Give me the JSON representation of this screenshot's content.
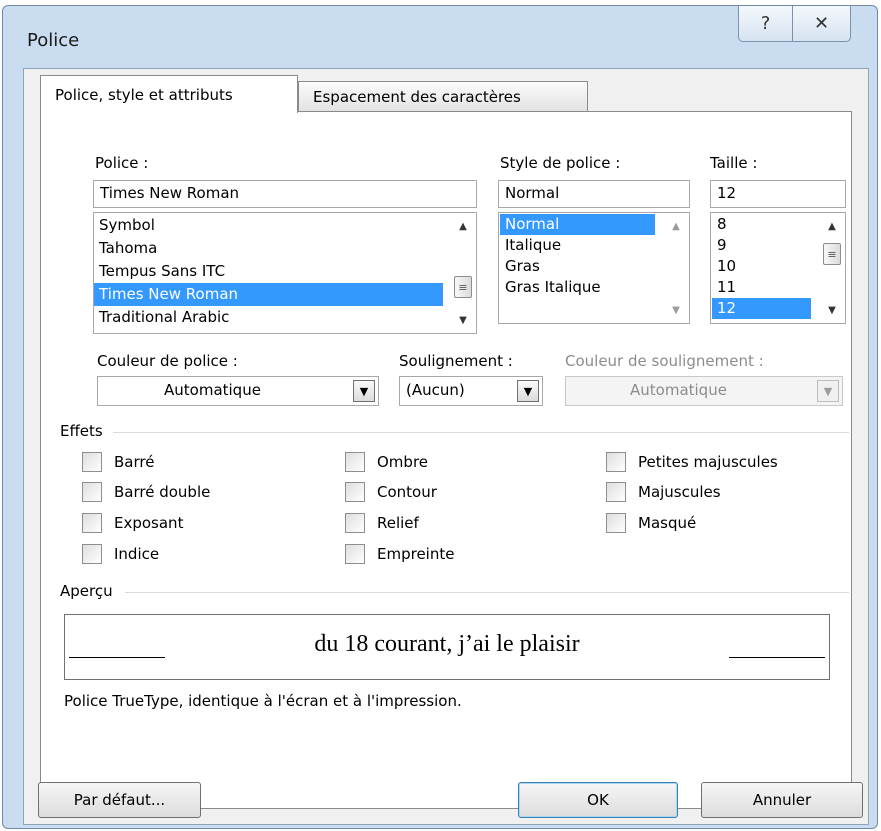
{
  "window": {
    "title": "Police",
    "help_glyph": "?",
    "close_glyph": "✕"
  },
  "tabs": [
    {
      "label": "Police, style et attributs",
      "active": true
    },
    {
      "label": "Espacement des caractères",
      "active": false
    }
  ],
  "font": {
    "label": "Police :",
    "value": "Times New Roman",
    "items": [
      "Symbol",
      "Tahoma",
      "Tempus Sans ITC",
      "Times New Roman",
      "Traditional Arabic"
    ],
    "selected": "Times New Roman"
  },
  "style": {
    "label": "Style de police :",
    "value": "Normal",
    "items": [
      "Normal",
      "Italique",
      "Gras",
      "Gras Italique"
    ],
    "selected": "Normal"
  },
  "size": {
    "label": "Taille :",
    "value": "12",
    "items": [
      "8",
      "9",
      "10",
      "11",
      "12"
    ],
    "selected": "12"
  },
  "font_color": {
    "label": "Couleur de police :",
    "value": "Automatique"
  },
  "underline": {
    "label": "Soulignement :",
    "value": "(Aucun)"
  },
  "underline_color": {
    "label": "Couleur de soulignement :",
    "value": "Automatique",
    "enabled": false
  },
  "effects": {
    "title": "Effets",
    "col1": [
      "Barré",
      "Barré double",
      "Exposant",
      "Indice"
    ],
    "col2": [
      "Ombre",
      "Contour",
      "Relief",
      "Empreinte"
    ],
    "col3": [
      "Petites majuscules",
      "Majuscules",
      "Masqué"
    ],
    "checked": []
  },
  "preview": {
    "title": "Aperçu",
    "sample": "du 18 courant, j’ai le plaisir",
    "note": "Police TrueType, identique à l'écran et à l'impression."
  },
  "buttons": {
    "default": "Par défaut...",
    "ok": "OK",
    "cancel": "Annuler"
  },
  "colors": {
    "frame": "#c9dcf0",
    "selection": "#3399ff",
    "dialog_bg": "#f0f0f0"
  }
}
